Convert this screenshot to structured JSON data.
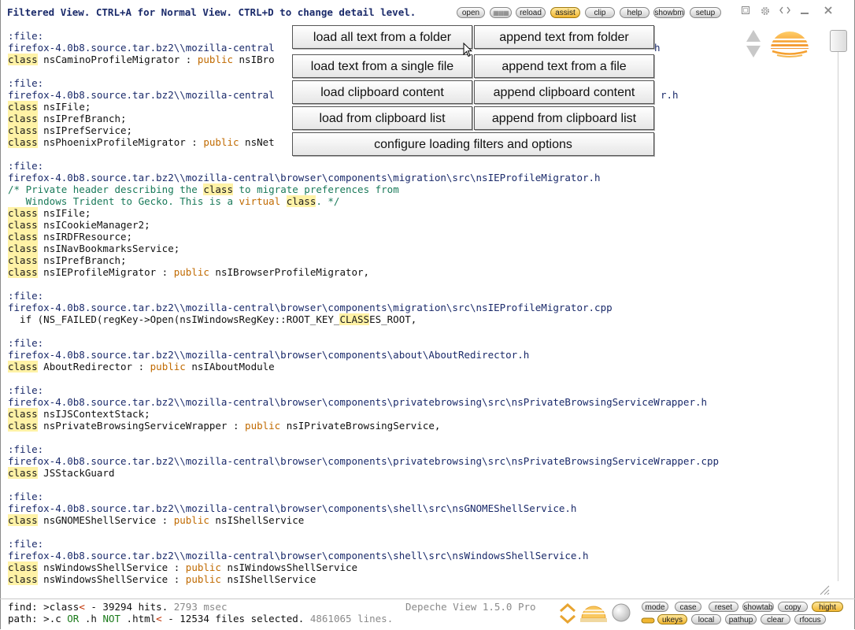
{
  "header": {
    "title": "Filtered View. CTRL+A for Normal View. CTRL+D to change detail level.",
    "buttons": [
      {
        "label": "open",
        "name": "open-button"
      },
      {
        "label": "▦▦▦",
        "name": "list-view-button"
      },
      {
        "label": "reload",
        "name": "reload-button"
      },
      {
        "label": "assist",
        "name": "assist-button",
        "active": true
      },
      {
        "label": "clip",
        "name": "clip-button"
      },
      {
        "label": "help",
        "name": "help-button"
      },
      {
        "label": "showbm",
        "name": "showbm-button"
      },
      {
        "label": "setup",
        "name": "setup-button"
      }
    ],
    "window_icons": [
      "restore-icon",
      "gear-icon",
      "code-icon",
      "minimize-icon",
      "close-icon"
    ]
  },
  "popup": {
    "items": [
      "load all text from a folder",
      "append text from folder",
      "load text from a single file",
      "append text from a file",
      "load clipboard content",
      "append clipboard content",
      "load from clipboard list",
      "append from clipboard list",
      "configure loading filters and options"
    ]
  },
  "content": {
    "blocks": [
      {
        "label": ":file:",
        "path": "firefox-4.0b8.source.tar.bz2\\\\mozilla-central",
        "path_tail": "h",
        "lines": [
          [
            {
              "k": "class"
            },
            {
              "t": " nsCaminoProfileMigrator : "
            },
            {
              "p": "public"
            },
            {
              "t": " nsIBro"
            }
          ]
        ]
      },
      {
        "label": ":file:",
        "path": "firefox-4.0b8.source.tar.bz2\\\\mozilla-central",
        "path_tail": "r.h",
        "lines": [
          [
            {
              "k": "class"
            },
            {
              "t": " nsIFile;"
            }
          ],
          [
            {
              "k": "class"
            },
            {
              "t": " nsIPrefBranch;"
            }
          ],
          [
            {
              "k": "class"
            },
            {
              "t": " nsIPrefService;"
            }
          ],
          [
            {
              "k": "class"
            },
            {
              "t": " nsPhoenixProfileMigrator : "
            },
            {
              "p": "public"
            },
            {
              "t": " nsNet"
            }
          ]
        ]
      },
      {
        "label": ":file:",
        "path": "firefox-4.0b8.source.tar.bz2\\\\mozilla-central\\browser\\components\\migration\\src\\nsIEProfileMigrator.h",
        "lines": [
          [
            {
              "c": "/* Private header describing the "
            },
            {
              "k": "class"
            },
            {
              "c": " to migrate preferences from"
            }
          ],
          [
            {
              "c": "   Windows Trident to Gecko. This is a "
            },
            {
              "p": "virtual"
            },
            {
              "c": " "
            },
            {
              "k": "class"
            },
            {
              "c": ". */"
            }
          ],
          [
            {
              "k": "class"
            },
            {
              "t": " nsIFile;"
            }
          ],
          [
            {
              "k": "class"
            },
            {
              "t": " nsICookieManager2;"
            }
          ],
          [
            {
              "k": "class"
            },
            {
              "t": " nsIRDFResource;"
            }
          ],
          [
            {
              "k": "class"
            },
            {
              "t": " nsINavBookmarksService;"
            }
          ],
          [
            {
              "k": "class"
            },
            {
              "t": " nsIPrefBranch;"
            }
          ],
          [
            {
              "k": "class"
            },
            {
              "t": " nsIEProfileMigrator : "
            },
            {
              "p": "public"
            },
            {
              "t": " nsIBrowserProfileMigrator,"
            }
          ]
        ]
      },
      {
        "label": ":file:",
        "path": "firefox-4.0b8.source.tar.bz2\\\\mozilla-central\\browser\\components\\migration\\src\\nsIEProfileMigrator.cpp",
        "lines": [
          [
            {
              "t": "  if (NS_FAILED(regKey->Open(nsIWindowsRegKey::ROOT_KEY_"
            },
            {
              "k": "CLASS"
            },
            {
              "t": "ES_ROOT,"
            }
          ]
        ]
      },
      {
        "label": ":file:",
        "path": "firefox-4.0b8.source.tar.bz2\\\\mozilla-central\\browser\\components\\about\\AboutRedirector.h",
        "lines": [
          [
            {
              "k": "class"
            },
            {
              "t": " AboutRedirector : "
            },
            {
              "p": "public"
            },
            {
              "t": " nsIAboutModule"
            }
          ]
        ]
      },
      {
        "label": ":file:",
        "path": "firefox-4.0b8.source.tar.bz2\\\\mozilla-central\\browser\\components\\privatebrowsing\\src\\nsPrivateBrowsingServiceWrapper.h",
        "lines": [
          [
            {
              "k": "class"
            },
            {
              "t": " nsIJSContextStack;"
            }
          ],
          [
            {
              "k": "class"
            },
            {
              "t": " nsPrivateBrowsingServiceWrapper : "
            },
            {
              "p": "public"
            },
            {
              "t": " nsIPrivateBrowsingService,"
            }
          ]
        ]
      },
      {
        "label": ":file:",
        "path": "firefox-4.0b8.source.tar.bz2\\\\mozilla-central\\browser\\components\\privatebrowsing\\src\\nsPrivateBrowsingServiceWrapper.cpp",
        "lines": [
          [
            {
              "k": "class"
            },
            {
              "t": " JSStackGuard"
            }
          ]
        ]
      },
      {
        "label": ":file:",
        "path": "firefox-4.0b8.source.tar.bz2\\\\mozilla-central\\browser\\components\\shell\\src\\nsGNOMEShellService.h",
        "lines": [
          [
            {
              "k": "class"
            },
            {
              "t": " nsGNOMEShellService : "
            },
            {
              "p": "public"
            },
            {
              "t": " nsIShellService"
            }
          ]
        ]
      },
      {
        "label": ":file:",
        "path": "firefox-4.0b8.source.tar.bz2\\\\mozilla-central\\browser\\components\\shell\\src\\nsWindowsShellService.h",
        "lines": [
          [
            {
              "k": "class"
            },
            {
              "t": " nsWindowsShellService : "
            },
            {
              "p": "public"
            },
            {
              "t": " nsIWindowsShellService"
            }
          ],
          [
            {
              "k": "class"
            },
            {
              "t": " nsWindowsShellService : "
            },
            {
              "p": "public"
            },
            {
              "t": " nsIShellService"
            }
          ]
        ]
      }
    ]
  },
  "footer": {
    "find_label": "find: >",
    "find_value": "class",
    "find_cursor": "<",
    "find_hits": " - 39294 hits. ",
    "find_time": "2793 msec",
    "path_label": "path: >",
    "path_c": ".c ",
    "path_or": "OR",
    "path_h": " .h ",
    "path_not": "NOT",
    "path_html": " .html",
    "path_cursor": "<",
    "path_files": " - 12534 files selected. ",
    "path_lines": "4861065 lines.",
    "app_name": "Depeche View 1.5.0 Pro",
    "buttons_row1": [
      {
        "label": "mode",
        "name": "mode-button"
      },
      {
        "label": "case",
        "name": "case-button"
      },
      {
        "label": "reset",
        "name": "reset-button"
      },
      {
        "label": "showtab",
        "name": "showtab-button"
      },
      {
        "label": "copy",
        "name": "copy-button"
      },
      {
        "label": "hight",
        "name": "hight-button",
        "active": true
      }
    ],
    "buttons_row2": [
      {
        "label": "ukeys",
        "name": "ukeys-button",
        "active": true
      },
      {
        "label": "local",
        "name": "local-button"
      },
      {
        "label": "pathup",
        "name": "pathup-button"
      },
      {
        "label": "clear",
        "name": "clear-button"
      },
      {
        "label": "rfocus",
        "name": "rfocus-button"
      }
    ]
  },
  "colors": {
    "accent": "#f1b733",
    "path_text": "#1a2a6a",
    "keyword_bg": "#fff2a6",
    "public_text": "#c06a00",
    "comment_text": "#1a7a5a"
  }
}
